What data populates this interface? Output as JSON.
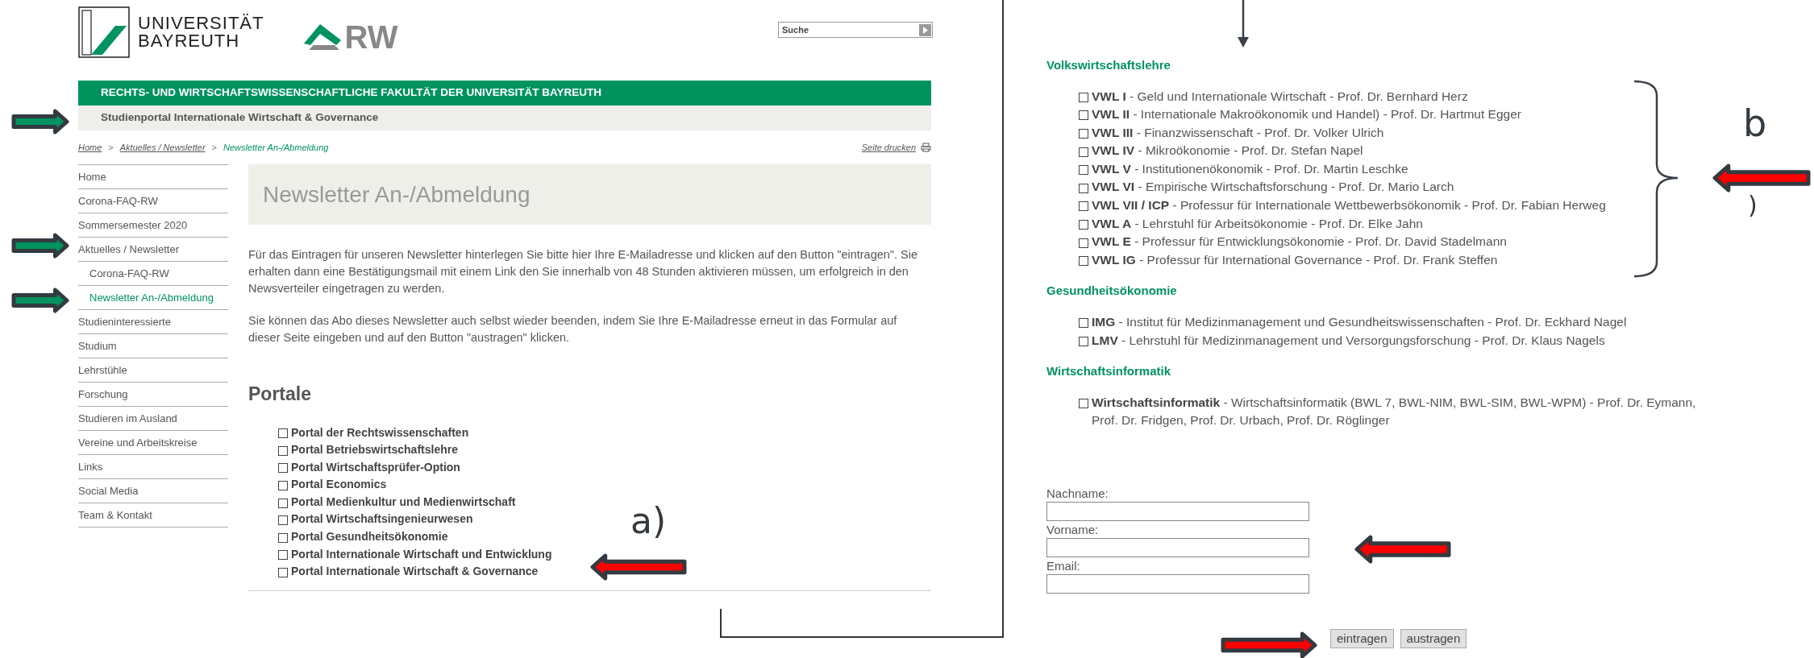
{
  "header": {
    "logo_lines": [
      "UNIVERSITÄT",
      "BAYREUTH"
    ],
    "rw_logo": "RW",
    "search": {
      "placeholder": "Suche"
    }
  },
  "faculty_bar": "RECHTS- UND WIRTSCHAFTSWISSENSCHAFTLICHE FAKULTÄT DER UNIVERSITÄT BAYREUTH",
  "portal_bar": "Studienportal Internationale Wirtschaft & Governance",
  "breadcrumb": {
    "separator": ">",
    "items": [
      {
        "label": "Home",
        "current": false
      },
      {
        "label": "Aktuelles / Newsletter",
        "current": false
      },
      {
        "label": "Newsletter An-/Abmeldung",
        "current": true
      }
    ]
  },
  "print_link": "Seite drucken",
  "sidebar": {
    "items": [
      {
        "label": "Home",
        "selected": false
      },
      {
        "label": "Corona-FAQ-RW",
        "selected": false
      },
      {
        "label": "Sommersemester 2020",
        "selected": false
      },
      {
        "label": "Aktuelles / Newsletter",
        "selected": false,
        "children": [
          {
            "label": "Corona-FAQ-RW",
            "selected": false
          },
          {
            "label": "Newsletter An-/Abmeldung",
            "selected": true
          }
        ]
      },
      {
        "label": "Studieninteressierte",
        "selected": false
      },
      {
        "label": "Studium",
        "selected": false
      },
      {
        "label": "Lehrstühle",
        "selected": false
      },
      {
        "label": "Forschung",
        "selected": false
      },
      {
        "label": "Studieren im Ausland",
        "selected": false
      },
      {
        "label": "Vereine und Arbeitskreise",
        "selected": false
      },
      {
        "label": "Links",
        "selected": false
      },
      {
        "label": "Social Media",
        "selected": false
      },
      {
        "label": "Team & Kontakt",
        "selected": false
      }
    ]
  },
  "page_title": "Newsletter An-/Abmeldung",
  "paragraphs": [
    "Für das Eintragen für unseren Newsletter hinterlegen Sie bitte hier Ihre E-Mailadresse und klicken auf den Button \"eintragen\". Sie erhalten dann eine Bestätigungsmail mit einem Link den Sie innerhalb von 48 Stunden aktivieren müssen, um erfolgreich in den Newsverteiler eingetragen zu werden.",
    "Sie können das Abo dieses Newsletter auch selbst wieder beenden, indem Sie Ihre E-Mailadresse erneut in das Formular auf dieser Seite eingeben und auf den Button \"austragen\" klicken."
  ],
  "portale": {
    "heading": "Portale",
    "items": [
      {
        "label": "Portal der Rechtswissenschaften",
        "checked": false
      },
      {
        "label": "Portal Betriebswirtschaftslehre",
        "checked": false
      },
      {
        "label": "Portal Wirtschaftsprüfer-Option",
        "checked": false
      },
      {
        "label": "Portal Economics",
        "checked": false
      },
      {
        "label": "Portal Medienkultur und Medienwirtschaft",
        "checked": false
      },
      {
        "label": "Portal Wirtschaftsingenieurwesen",
        "checked": false
      },
      {
        "label": "Portal Gesundheitsökonomie",
        "checked": false
      },
      {
        "label": "Portal Internationale Wirtschaft und Entwicklung",
        "checked": false
      },
      {
        "label": "Portal Internationale Wirtschaft & Governance",
        "checked": false
      }
    ]
  },
  "sections": [
    {
      "heading": "Volkswirtschaftslehre",
      "items": [
        {
          "code": "VWL I",
          "text": "- Geld und Internationale Wirtschaft - Prof. Dr. Bernhard Herz",
          "checked": false
        },
        {
          "code": "VWL II",
          "text": "- Internationale Makroökonomik und Handel) - Prof. Dr. Hartmut Egger",
          "checked": false
        },
        {
          "code": "VWL III",
          "text": "- Finanzwissenschaft - Prof. Dr. Volker Ulrich",
          "checked": false
        },
        {
          "code": "VWL IV",
          "text": "- Mikroökonomie - Prof. Dr. Stefan Napel",
          "checked": false
        },
        {
          "code": "VWL V",
          "text": "- Institutionenökonomik - Prof. Dr. Martin Leschke",
          "checked": false
        },
        {
          "code": "VWL VI",
          "text": "- Empirische Wirtschaftsforschung - Prof. Dr. Mario Larch",
          "checked": false
        },
        {
          "code": "VWL VII / ICP",
          "text": "- Professur für Internationale Wettbewerbsökonomik - Prof. Dr. Fabian Herweg",
          "checked": false
        },
        {
          "code": "VWL A",
          "text": "- Lehrstuhl für Arbeitsökonomie - Prof. Dr. Elke Jahn",
          "checked": false
        },
        {
          "code": "VWL E",
          "text": "- Professur für Entwicklungsökonomie - Prof. Dr. David Stadelmann",
          "checked": false
        },
        {
          "code": "VWL IG",
          "text": "- Professur für International Governance - Prof. Dr. Frank Steffen",
          "checked": false
        }
      ]
    },
    {
      "heading": "Gesundheitsökonomie",
      "items": [
        {
          "code": "IMG",
          "text": "- Institut für Medizinmanagement und Gesundheitswissenschaften - Prof. Dr. Eckhard Nagel",
          "checked": false
        },
        {
          "code": "LMV",
          "text": "- Lehrstuhl für Medizinmanagement und Versorgungsforschung - Prof. Dr. Klaus Nagels",
          "checked": false
        }
      ]
    },
    {
      "heading": "Wirtschaftsinformatik",
      "items": [
        {
          "code": "Wirtschaftsinformatik",
          "text": "- Wirtschaftsinformatik (BWL 7, BWL-NIM, BWL-SIM, BWL-WPM) - Prof. Dr. Eymann, Prof. Dr. Fridgen, Prof. Dr. Urbach, Prof. Dr. Röglinger",
          "checked": false
        }
      ]
    }
  ],
  "form": {
    "fields": [
      {
        "label": "Nachname:"
      },
      {
        "label": "Vorname:"
      },
      {
        "label": "Email:"
      }
    ],
    "buttons": [
      "eintragen",
      "austragen"
    ]
  },
  "annotations": {
    "labels": [
      "a)",
      "b",
      ")"
    ]
  }
}
